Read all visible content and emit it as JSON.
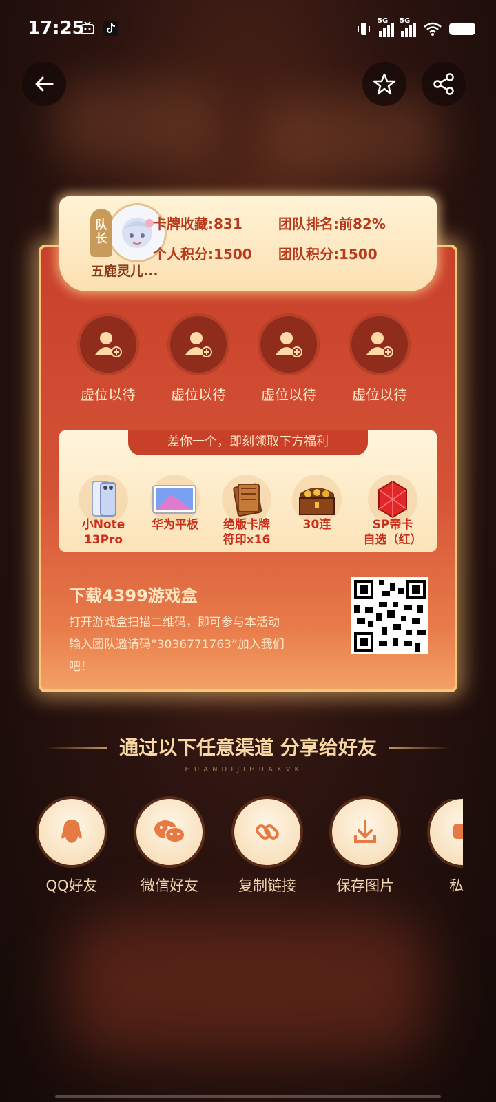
{
  "status_bar": {
    "time": "17:25",
    "network_1": "5G",
    "network_2": "5G"
  },
  "team": {
    "captain_tag": [
      "队",
      "长"
    ],
    "leader_name": "五鹿灵儿...",
    "card_collection": "卡牌收藏:831",
    "team_rank": "团队排名:前82%",
    "personal_points": "个人积分:1500",
    "team_points": "团队积分:1500",
    "empty_slots": [
      "虚位以待",
      "虚位以待",
      "虚位以待",
      "虚位以待"
    ]
  },
  "rewards": {
    "banner": "差你一个，即刻领取下方福利",
    "items": [
      {
        "line1": "小Note",
        "line2": "13Pro"
      },
      {
        "line1": "华为平板",
        "line2": ""
      },
      {
        "line1": "绝版卡牌",
        "line2": "符印x16"
      },
      {
        "line1": "30连",
        "line2": ""
      },
      {
        "line1": "SP帝卡",
        "line2": "自选（红）"
      }
    ]
  },
  "download": {
    "title": "下载4399游戏盒",
    "desc_line1": "打开游戏盒扫描二维码，即可参与本活动",
    "desc_line2": "输入团队邀请码“3036771763”加入我们",
    "desc_line3": "吧！"
  },
  "share": {
    "title": "通过以下任意渠道  分享给好友",
    "subtitle": "HUANDIJIHUAXVKL",
    "channels": [
      {
        "label": "QQ好友",
        "icon": "qq-icon"
      },
      {
        "label": "微信好友",
        "icon": "wechat-icon"
      },
      {
        "label": "复制链接",
        "icon": "link-icon"
      },
      {
        "label": "保存图片",
        "icon": "download-icon"
      },
      {
        "label": "私",
        "icon": "message-icon"
      }
    ]
  },
  "colors": {
    "card_red": "#c8402a",
    "gold": "#f5c878",
    "cream": "#fff3d6",
    "accent_text": "#b83a1c"
  }
}
